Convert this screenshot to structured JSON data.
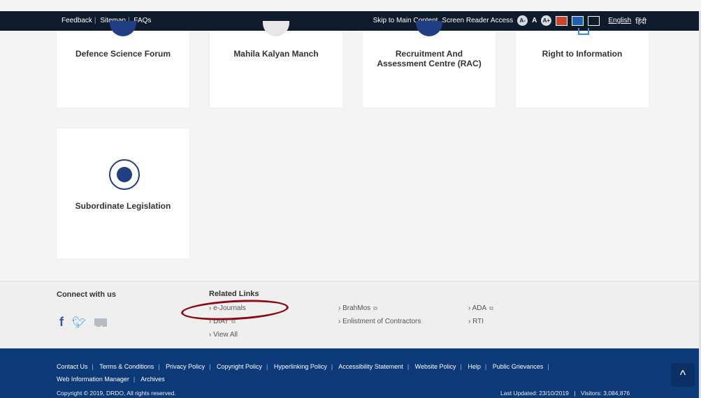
{
  "topbar": {
    "links": [
      "Feedback",
      "Sitemap",
      "FAQs"
    ],
    "skip": "Skip to Main Content",
    "screen_reader": "Screen Reader Access",
    "font_minus": "A-",
    "font_normal": "A",
    "font_plus": "A+",
    "lang_en": "English",
    "lang_hi": "हिंदी"
  },
  "cards": [
    {
      "title": "Defence Science Forum"
    },
    {
      "title": "Mahila Kalyan Manch"
    },
    {
      "title": "Recruitment And Assessment Centre (RAC)"
    },
    {
      "title": "Right to Information"
    },
    {
      "title": "Subordinate Legislation"
    }
  ],
  "footer": {
    "connect": "Connect with us",
    "related": "Related Links",
    "links": [
      "e-Journals",
      "DIAT",
      "View All",
      "BrahMos",
      "Enlistment of Contractors",
      "ADA",
      "RTI"
    ],
    "bottom_links": [
      "Contact Us",
      "Terms & Conditions",
      "Privacy Policy",
      "Copyright Policy",
      "Hyperlinking Policy",
      "Accessibility Statement",
      "Website Policy",
      "Help",
      "Public Grievances",
      "Web Information Manager",
      "Archives"
    ],
    "copyright": "Copyright © 2019, DRDO, All rights reserved.",
    "last_updated": "Last Updated: 23/10/2019",
    "visitors": "Visitors: 3,084,876"
  },
  "colors": {
    "topbar": "#0d1b2d",
    "footer_dark": "#0c3a78",
    "highlight_oval": "#8b0a13"
  }
}
